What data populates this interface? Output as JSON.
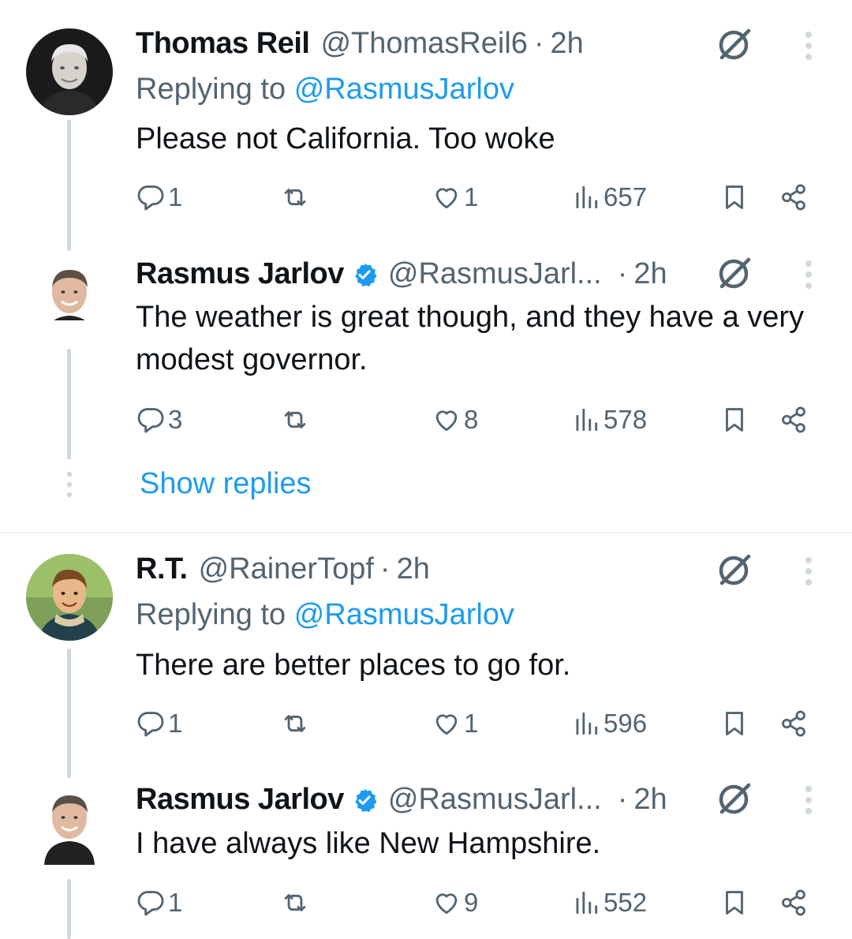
{
  "tweets": [
    {
      "name": "Thomas Reil",
      "handle": "@ThomasReil6",
      "sep": "·",
      "time": "2h",
      "replying_label": "Replying to",
      "replying_to": "@RasmusJarlov",
      "text": "Please not California. Too woke",
      "replies": "1",
      "retweets": "",
      "likes": "1",
      "views": "657",
      "verified": false
    },
    {
      "name": "Rasmus Jarlov",
      "handle": "@RasmusJarl...",
      "sep": "·",
      "time": "2h",
      "text": "The weather is great though, and they have a very modest governor.",
      "replies": "3",
      "retweets": "",
      "likes": "8",
      "views": "578",
      "verified": true
    },
    {
      "name": "R.T.",
      "handle": "@RainerTopf",
      "sep": "·",
      "time": "2h",
      "replying_label": "Replying to",
      "replying_to": "@RasmusJarlov",
      "text": "There are better places to go for.",
      "replies": "1",
      "retweets": "",
      "likes": "1",
      "views": "596",
      "verified": false
    },
    {
      "name": "Rasmus Jarlov",
      "handle": "@RasmusJarl...",
      "sep": "·",
      "time": "2h",
      "text": "I have always like New Hampshire.",
      "replies": "1",
      "retweets": "",
      "likes": "9",
      "views": "552",
      "verified": true
    }
  ],
  "show_replies": "Show replies",
  "icons": {
    "reply": "reply-icon",
    "retweet": "retweet-icon",
    "like": "like-icon",
    "views": "views-icon",
    "bookmark": "bookmark-icon",
    "share": "share-icon",
    "grok": "grok-icon",
    "more": "more-icon",
    "verified": "verified-badge-icon"
  },
  "colors": {
    "text": "#0f1419",
    "secondary": "#536471",
    "accent": "#1d9bf0",
    "thread_line": "#cfd9de"
  }
}
